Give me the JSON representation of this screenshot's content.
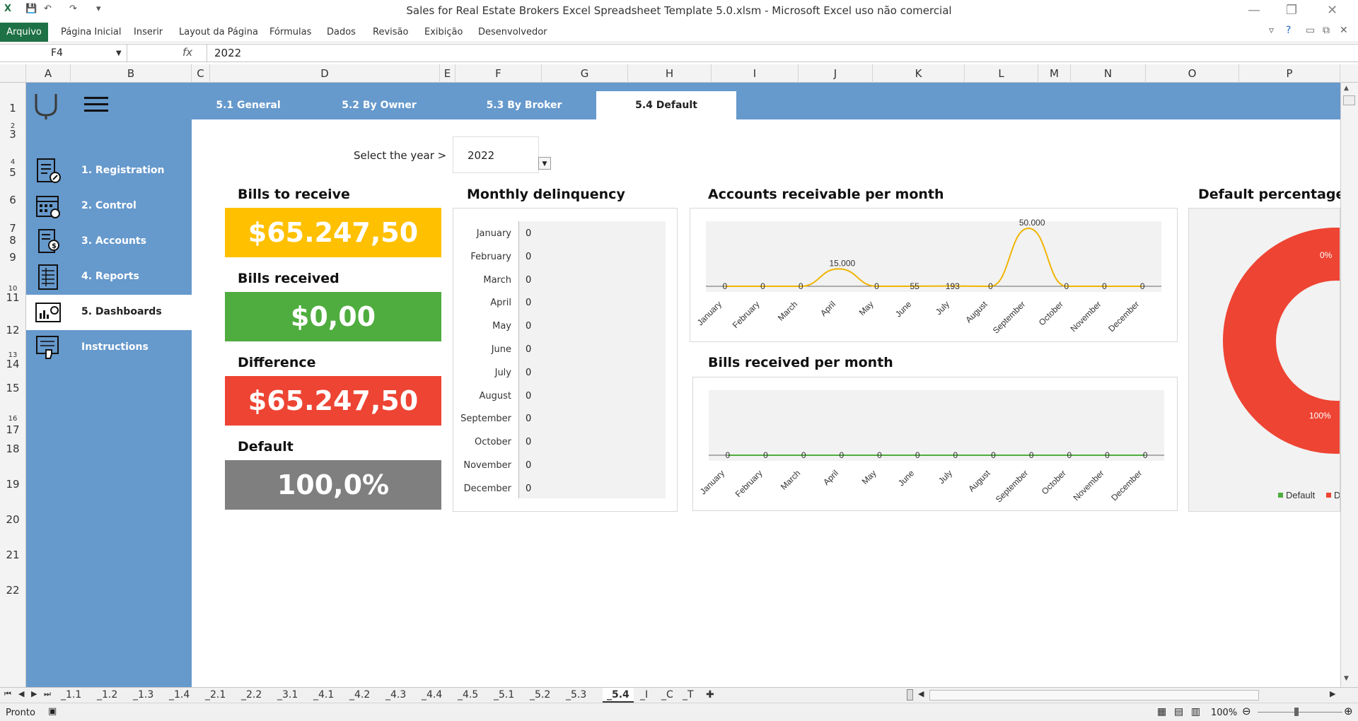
{
  "window": {
    "title": "Sales for Real Estate Brokers Excel Spreadsheet Template 5.0.xlsm - Microsoft Excel uso não comercial"
  },
  "menu": {
    "file": "Arquivo",
    "items": [
      "Página Inicial",
      "Inserir",
      "Layout da Página",
      "Fórmulas",
      "Dados",
      "Revisão",
      "Exibição",
      "Desenvolvedor"
    ]
  },
  "formula_bar": {
    "cell_ref": "F4",
    "fx": "fx",
    "value": "2022"
  },
  "columns": [
    "A",
    "B",
    "C",
    "D",
    "E",
    "F",
    "G",
    "H",
    "I",
    "J",
    "K",
    "L",
    "M",
    "N",
    "O",
    "P"
  ],
  "rows": [
    "1",
    "2",
    "3",
    "4",
    "5",
    "6",
    "7",
    "8",
    "9",
    "10",
    "11",
    "12",
    "13",
    "14",
    "15",
    "16",
    "17",
    "18",
    "19",
    "20",
    "21",
    "22"
  ],
  "sidebar": {
    "items": [
      {
        "label": "1. Registration",
        "icon": "registration-icon"
      },
      {
        "label": "2. Control",
        "icon": "calendar-icon"
      },
      {
        "label": "3. Accounts",
        "icon": "accounts-icon"
      },
      {
        "label": "4. Reports",
        "icon": "reports-icon"
      },
      {
        "label": "5. Dashboards",
        "icon": "dashboard-icon"
      },
      {
        "label": "Instructions",
        "icon": "instructions-icon"
      }
    ]
  },
  "dash_tabs": [
    "5.1 General",
    "5.2 By Owner",
    "5.3 By Broker",
    "5.4 Default"
  ],
  "year_selector": {
    "label": "Select the year >",
    "value": "2022"
  },
  "kpis": {
    "bills_to_receive": {
      "title": "Bills to receive",
      "value": "$65.247,50",
      "color": "#ffc000"
    },
    "bills_received": {
      "title": "Bills received",
      "value": "$0,00",
      "color": "#4fad3f"
    },
    "difference": {
      "title": "Difference",
      "value": "$65.247,50",
      "color": "#ee4433"
    },
    "default": {
      "title": "Default",
      "value": "100,0%",
      "color": "#7f7f7f"
    }
  },
  "monthly_delinquency": {
    "title": "Monthly delinquency",
    "months": [
      "January",
      "February",
      "March",
      "April",
      "May",
      "June",
      "July",
      "August",
      "September",
      "October",
      "November",
      "December"
    ],
    "values": [
      "0",
      "0",
      "0",
      "0",
      "0",
      "0",
      "0",
      "0",
      "0",
      "0",
      "0",
      "0"
    ]
  },
  "chart_data": [
    {
      "type": "line",
      "title": "Accounts receivable per month",
      "categories": [
        "January",
        "February",
        "March",
        "April",
        "May",
        "June",
        "July",
        "August",
        "September",
        "October",
        "November",
        "December"
      ],
      "values": [
        0,
        0,
        0,
        15000,
        0,
        55,
        193,
        0,
        50000,
        0,
        0,
        0
      ],
      "labels": [
        "0",
        "0",
        "0",
        "15.000",
        "0",
        "55",
        "193",
        "0",
        "50.000",
        "0",
        "0",
        "0"
      ],
      "color": "#f0b400"
    },
    {
      "type": "line",
      "title": "Bills received per month",
      "categories": [
        "January",
        "February",
        "March",
        "April",
        "May",
        "June",
        "July",
        "August",
        "September",
        "October",
        "November",
        "December"
      ],
      "values": [
        0,
        0,
        0,
        0,
        0,
        0,
        0,
        0,
        0,
        0,
        0,
        0
      ],
      "labels": [
        "0",
        "0",
        "0",
        "0",
        "0",
        "0",
        "0",
        "0",
        "0",
        "0",
        "0",
        "0"
      ],
      "color": "#4fad3f"
    },
    {
      "type": "pie",
      "title": "Default percentage",
      "slices": [
        {
          "name": "Default",
          "value": 0,
          "label": "0%",
          "color": "#4fad3f"
        },
        {
          "name": "D",
          "value": 100,
          "label": "100%",
          "color": "#ee4433"
        }
      ],
      "legend": [
        "Default",
        "D"
      ]
    }
  ],
  "sheet_tabs": [
    "_1.1",
    "_1.2",
    "_1.3",
    "_1.4",
    "_2.1",
    "_2.2",
    "_3.1",
    "_4.1",
    "_4.2",
    "_4.3",
    "_4.4",
    "_4.5",
    "_5.1",
    "_5.2",
    "_5.3",
    "_5.4",
    "_I",
    "_C",
    "_T"
  ],
  "active_sheet": "_5.4",
  "status": {
    "ready": "Pronto",
    "zoom": "100%"
  }
}
